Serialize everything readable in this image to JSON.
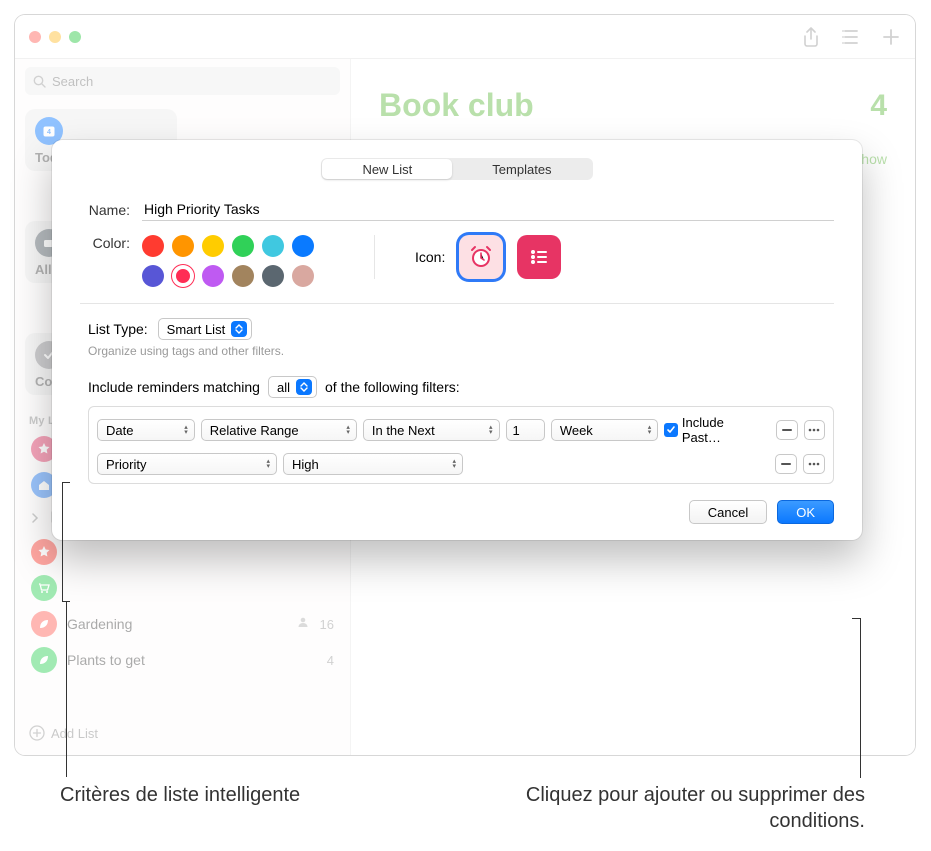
{
  "window": {
    "search_placeholder": "Search"
  },
  "toolbar": {
    "share_icon": "share-icon",
    "list_icon": "list-layout-icon",
    "add_icon": "plus-icon"
  },
  "sidebar": {
    "smart": {
      "today_label": "Today",
      "today_count": "4",
      "all_label": "All",
      "completed_label": "Completed"
    },
    "my_lists_label": "My Lists",
    "items": [
      {
        "name": "",
        "count": "",
        "color": "#e73464"
      },
      {
        "name": "",
        "count": "",
        "color": "#1f7af7"
      }
    ],
    "folder": {
      "name": "",
      "count": ""
    },
    "starred": {
      "name": "",
      "count": "",
      "color": "#ff3b30"
    },
    "green": {
      "name": "",
      "count": "",
      "color": "#30d158"
    },
    "gardening": {
      "name": "Gardening",
      "count": "16",
      "shared": true,
      "color": "#ff5f57"
    },
    "plants": {
      "name": "Plants to get",
      "count": "4",
      "color": "#30d158"
    },
    "add_list_label": "Add List"
  },
  "content": {
    "title": "Book club",
    "count": "4",
    "show_label": "Show"
  },
  "sheet": {
    "tabs": {
      "new_list": "New List",
      "templates": "Templates"
    },
    "name_label": "Name:",
    "name_value": "High Priority Tasks",
    "color_label": "Color:",
    "colors": [
      "#ff3b30",
      "#ff9500",
      "#ffcc00",
      "#30d158",
      "#40c8e0",
      "#0a7aff",
      "#5856d6",
      "#ff2d55",
      "#bf5af2",
      "#a2845e",
      "#5b6770",
      "#d9a8a0"
    ],
    "icon_label": "Icon:",
    "list_type_label": "List Type:",
    "list_type_value": "Smart List",
    "list_type_hint": "Organize using tags and other filters.",
    "match_prefix": "Include reminders matching",
    "match_mode": "all",
    "match_suffix": "of the following filters:",
    "filters": [
      {
        "field": "Date",
        "op": "Relative Range",
        "dir": "In the Next",
        "n": "1",
        "unit": "Week",
        "include_past": true,
        "include_past_label": "Include Past…"
      },
      {
        "field": "Priority",
        "value": "High"
      }
    ],
    "cancel": "Cancel",
    "ok": "OK"
  },
  "annotations": {
    "left": "Critères de liste intelligente",
    "right": "Cliquez pour ajouter ou supprimer des conditions."
  }
}
